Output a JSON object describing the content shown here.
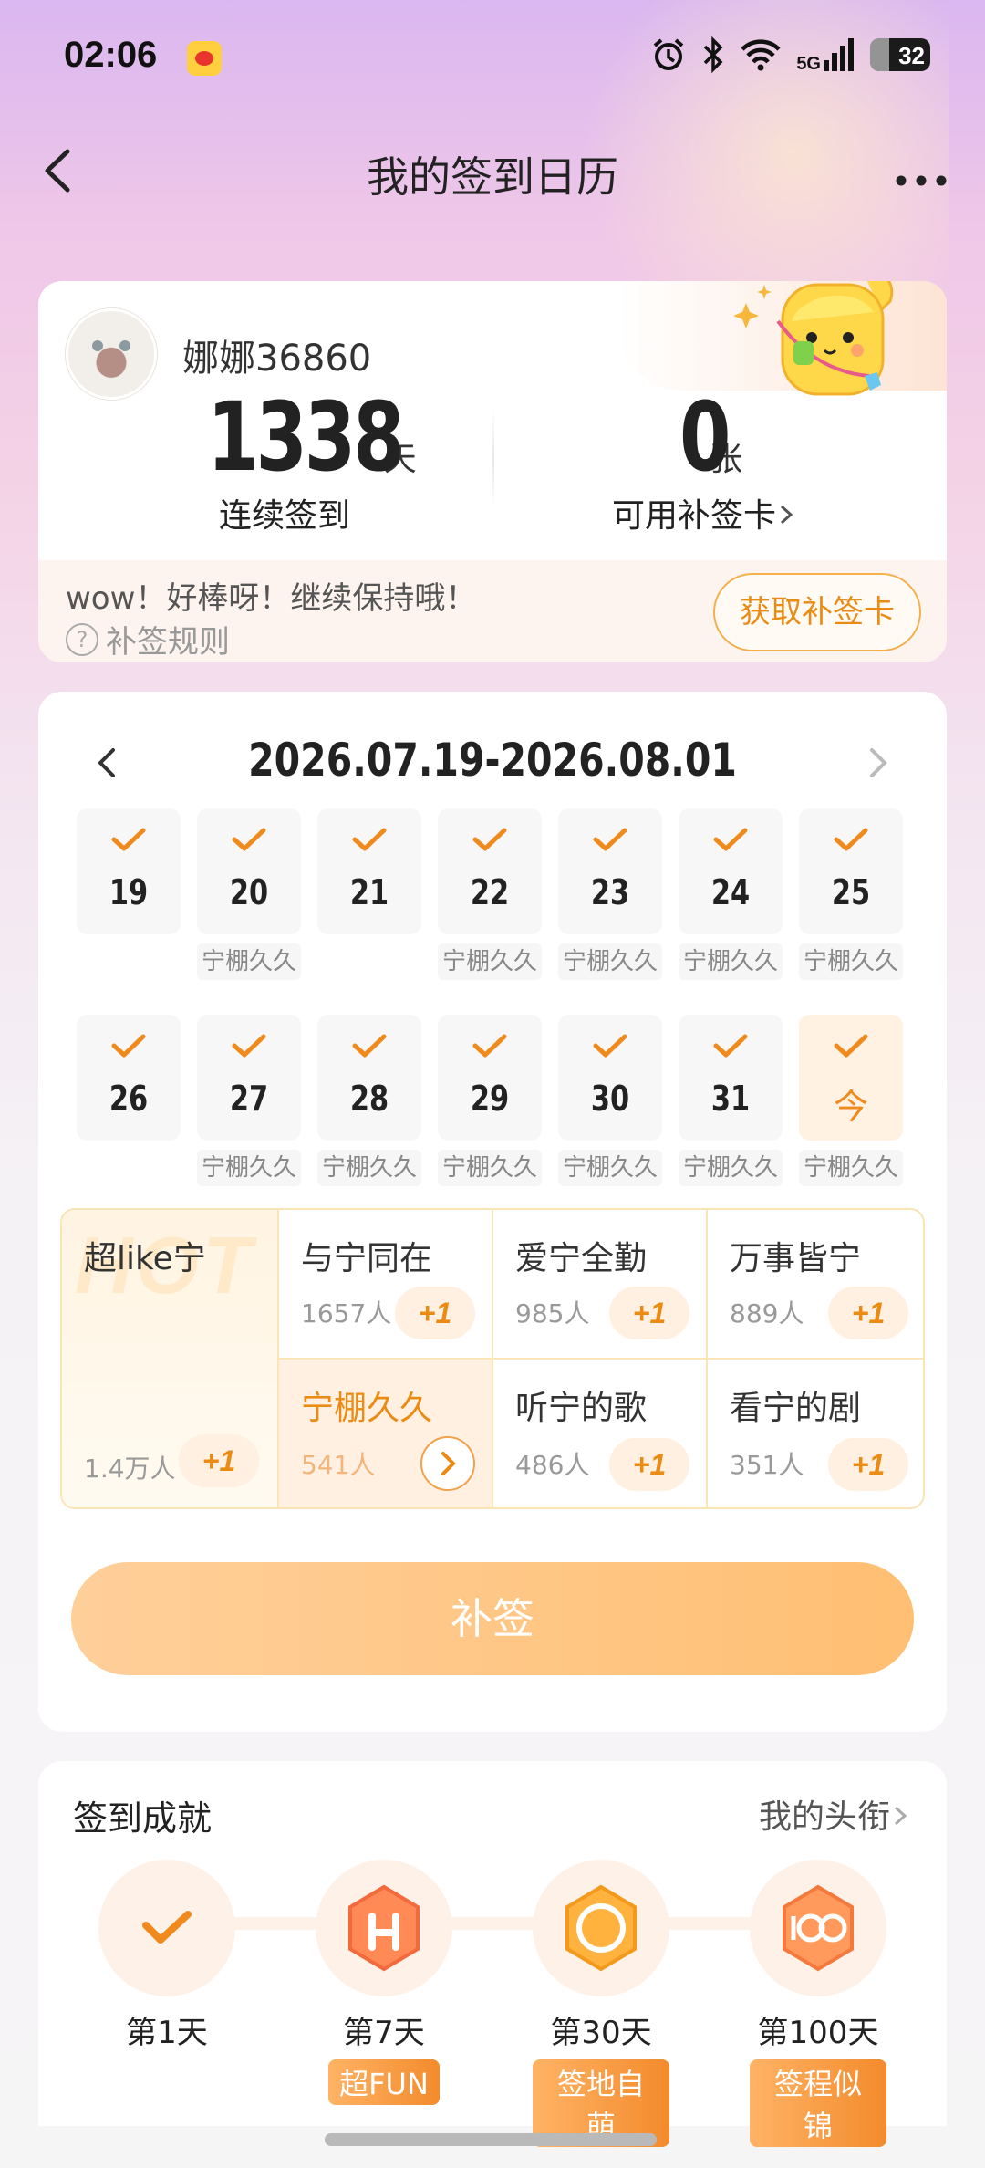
{
  "status_bar": {
    "time": "02:06",
    "network": "5G",
    "battery": "32"
  },
  "nav": {
    "title": "我的签到日历"
  },
  "profile": {
    "username": "娜娜36860",
    "streak_value": "1338",
    "streak_unit": "天",
    "streak_label": "连续签到",
    "cards_value": "0",
    "cards_unit": "张",
    "cards_label": "可用补签卡",
    "message": "wow！好棒呀！继续保持哦！",
    "rules_label": "补签规则",
    "get_card_button": "获取补签卡"
  },
  "calendar": {
    "range": "2026.07.19-2026.08.01",
    "days": [
      {
        "num": "19",
        "tag": ""
      },
      {
        "num": "20",
        "tag": "宁棚久久"
      },
      {
        "num": "21",
        "tag": ""
      },
      {
        "num": "22",
        "tag": "宁棚久久"
      },
      {
        "num": "23",
        "tag": "宁棚久久"
      },
      {
        "num": "24",
        "tag": "宁棚久久"
      },
      {
        "num": "25",
        "tag": "宁棚久久"
      },
      {
        "num": "26",
        "tag": ""
      },
      {
        "num": "27",
        "tag": "宁棚久久"
      },
      {
        "num": "28",
        "tag": "宁棚久久"
      },
      {
        "num": "29",
        "tag": "宁棚久久"
      },
      {
        "num": "30",
        "tag": "宁棚久久"
      },
      {
        "num": "31",
        "tag": "宁棚久久"
      },
      {
        "num": "今",
        "tag": "宁棚久久"
      }
    ],
    "topics_hot": "HOT",
    "topics": [
      {
        "name": "超like宁",
        "count": "1.4万人",
        "plus": "+1"
      },
      {
        "name": "与宁同在",
        "count": "1657人",
        "plus": "+1"
      },
      {
        "name": "爱宁全勤",
        "count": "985人",
        "plus": "+1"
      },
      {
        "name": "万事皆宁",
        "count": "889人",
        "plus": "+1"
      },
      {
        "name": "宁棚久久",
        "count": "541人",
        "plus": ""
      },
      {
        "name": "听宁的歌",
        "count": "486人",
        "plus": "+1"
      },
      {
        "name": "看宁的剧",
        "count": "351人",
        "plus": "+1"
      }
    ],
    "resign_button": "补签"
  },
  "achievements": {
    "title": "签到成就",
    "link": "我的头衔",
    "medals": [
      {
        "day": "第1天",
        "badge": "",
        "icon": "check-icon"
      },
      {
        "day": "第7天",
        "badge": "超FUN",
        "icon": "hand-horns-medal-icon"
      },
      {
        "day": "第30天",
        "badge": "签地自萌",
        "icon": "30-days-medal-icon"
      },
      {
        "day": "第100天",
        "badge": "签程似锦",
        "icon": "100-days-medal-icon"
      }
    ]
  },
  "colors": {
    "accent": "#F08A1C",
    "button": "#FFC47E"
  }
}
